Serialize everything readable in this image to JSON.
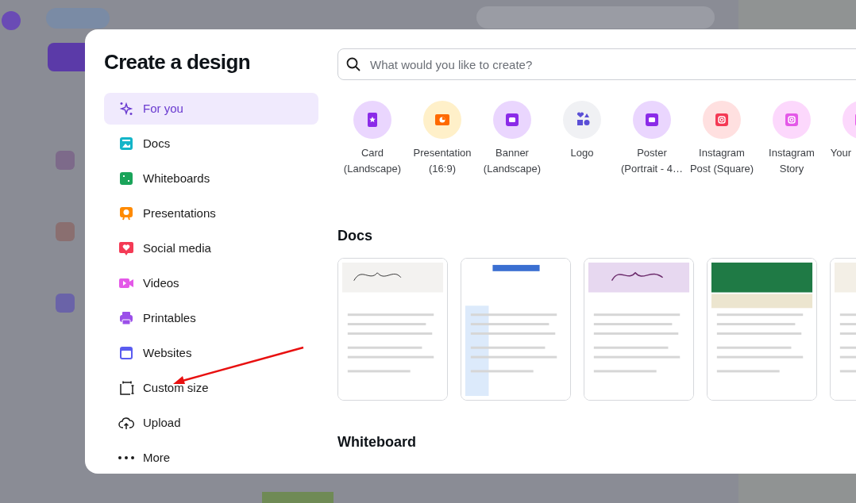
{
  "dialog": {
    "title": "Create a design"
  },
  "sidebar": {
    "items": [
      {
        "label": "For you",
        "selected": true
      },
      {
        "label": "Docs",
        "selected": false
      },
      {
        "label": "Whiteboards",
        "selected": false
      },
      {
        "label": "Presentations",
        "selected": false
      },
      {
        "label": "Social media",
        "selected": false
      },
      {
        "label": "Videos",
        "selected": false
      },
      {
        "label": "Printables",
        "selected": false
      },
      {
        "label": "Websites",
        "selected": false
      },
      {
        "label": "Custom size",
        "selected": false
      },
      {
        "label": "Upload",
        "selected": false
      },
      {
        "label": "More",
        "selected": false
      }
    ]
  },
  "search": {
    "placeholder": "What would you like to create?"
  },
  "design_types": [
    {
      "label": "Card\n(Landscape)"
    },
    {
      "label": "Presentation\n(16:9)"
    },
    {
      "label": "Banner\n(Landscape)"
    },
    {
      "label": "Logo"
    },
    {
      "label": "Poster\n(Portrait - 4…"
    },
    {
      "label": "Instagram\nPost (Square)"
    },
    {
      "label": "Instagram\nStory"
    },
    {
      "label": "Your"
    }
  ],
  "sections": [
    {
      "title": "Docs"
    },
    {
      "title": "Whiteboard"
    }
  ]
}
